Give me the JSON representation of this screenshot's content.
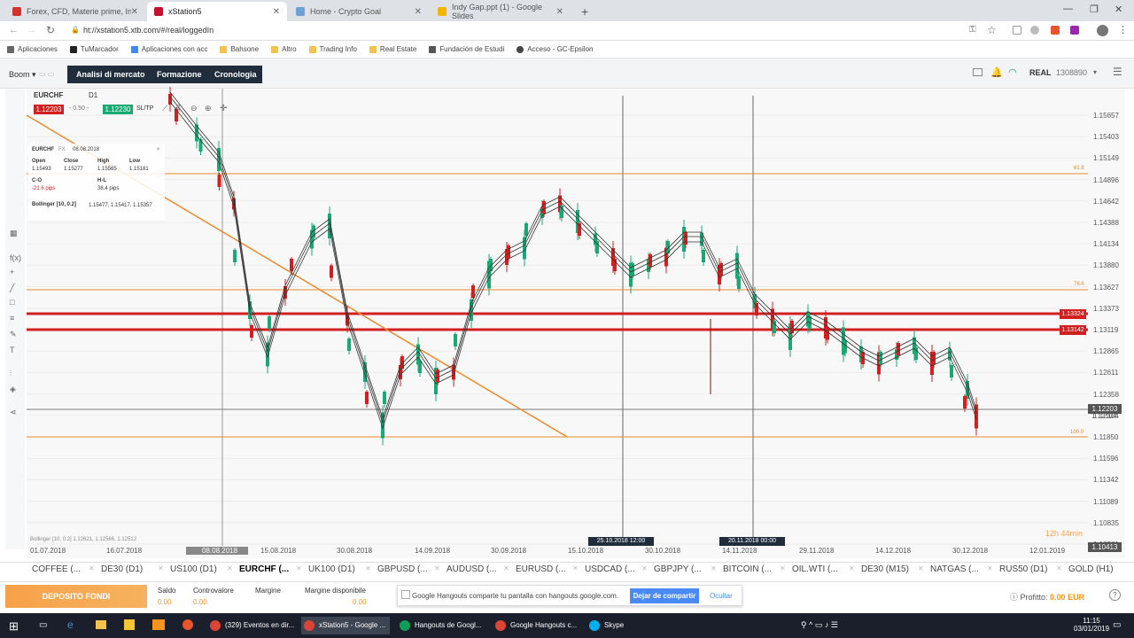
{
  "browser": {
    "tabs": [
      {
        "title": "Forex, CFD, Materie prime, Indici",
        "fav": "#d0342c"
      },
      {
        "title": "xStation5",
        "fav": "#c8102e"
      },
      {
        "title": "Home - Crypto Goal",
        "fav": "#6ea0d8"
      },
      {
        "title": "Indy Gap.ppt (1) - Google Slides",
        "fav": "#f4b400"
      }
    ],
    "url": "ht://xstation5.xtb.com/#/real/loggedIn",
    "bookmarks": [
      "Aplicaciones",
      "TuMarcador",
      "Aplicaciones con acc",
      "Bahsone",
      "Altro",
      "Trading Info",
      "Real Estate",
      "Fundación de Estudi",
      "Acceso - GC-Epsilon"
    ]
  },
  "app": {
    "mode": "Boom",
    "nav": [
      "Analisi di mercato",
      "Formazione",
      "Cronologia"
    ],
    "account_type": "REAL",
    "account_id": "1308890"
  },
  "chart": {
    "symbol": "EURCHF",
    "timeframe": "D1",
    "sell": "1.12203",
    "spread": "0.50",
    "buy": "1.12230",
    "sltp": "SL/TP",
    "infobox": {
      "symbol": "EURCHF",
      "type": "FX",
      "date": "08.08.2018",
      "open_label": "Open",
      "close_label": "Close",
      "high_label": "High",
      "low_label": "Low",
      "open": "1.15493",
      "close": "1.15277",
      "high": "1.15565",
      "low": "1.15181",
      "co_label": "C-O",
      "hl_label": "H-L",
      "co": "-21.6 pips",
      "hl": "38.4 pips",
      "boll_label": "Bollinger [10, 0.2]",
      "boll": "1.15477, 1.15417, 1.15357"
    },
    "price_ticks": [
      "1.15657",
      "1.15403",
      "1.15149",
      "1.14896",
      "1.14642",
      "1.14388",
      "1.14134",
      "1.13880",
      "1.13627",
      "1.13373",
      "1.13119",
      "1.12865",
      "1.12611",
      "1.12358",
      "1.12104",
      "1.11850",
      "1.11596",
      "1.11342",
      "1.11089",
      "1.10835",
      "1.10581"
    ],
    "date_ticks": [
      "01.07.2018",
      "16.07.2018",
      "08.08.2018",
      "15.08.2018",
      "30.08.2018",
      "14.09.2018",
      "30.09.2018",
      "15.10.2018",
      "30.10.2018",
      "14.11.2018",
      "29.11.2018",
      "14.12.2018",
      "30.12.2018",
      "12.01.2019"
    ],
    "cursor_dates": [
      "25.10.2018 12:00",
      "20.11.2018 00:00"
    ],
    "red_levels": [
      "1.13324",
      "1.13142"
    ],
    "current_price": "1.12203",
    "current_price_alt": "1.12104",
    "low_flag": "1.10413",
    "fib_labels": [
      "61.8",
      "78.6",
      "100.0"
    ],
    "countdown": "12h 44min",
    "bollinger_footer": "Bollinger [10, 0.2]  1.12621, 1.12566, 1.12512",
    "up_color": "#19a974",
    "down_color": "#d21f1f"
  },
  "instruments": [
    "COFFEE (...",
    "DE30 (D1)",
    "US100 (D1)",
    "EURCHF (...",
    "UK100 (D1)",
    "GBPUSD (...",
    "AUDUSD (...",
    "EURUSD (...",
    "USDCAD (...",
    "GBPJPY (...",
    "BITCOIN (...",
    "OIL.WTI (...",
    "DE30 (M15)",
    "NATGAS (...",
    "RUS50 (D1)",
    "GOLD (H1)"
  ],
  "account": {
    "deposit_label": "DEPOSITO FONDI",
    "fields": [
      {
        "label": "Saldo",
        "value": "0.00"
      },
      {
        "label": "Controvalore",
        "value": "0.00"
      },
      {
        "label": "Margine",
        "value": ""
      },
      {
        "label": "Margine disponibile",
        "value": "0.00"
      }
    ],
    "profit_label": "Profitto:",
    "profit_value": "0.00 EUR"
  },
  "hangouts": {
    "message": "Google Hangouts comparte tu pantalla con hangouts.google.com.",
    "stop": "Dejar de compartir",
    "hide": "Ocultar"
  },
  "taskbar": {
    "items": [
      "(329) Eventos en dir...",
      "xStation5 - Google ...",
      "Hangouts de Googl...",
      "Google Hangouts c...",
      "Skype"
    ],
    "time": "11:15",
    "date": "03/01/2019"
  }
}
